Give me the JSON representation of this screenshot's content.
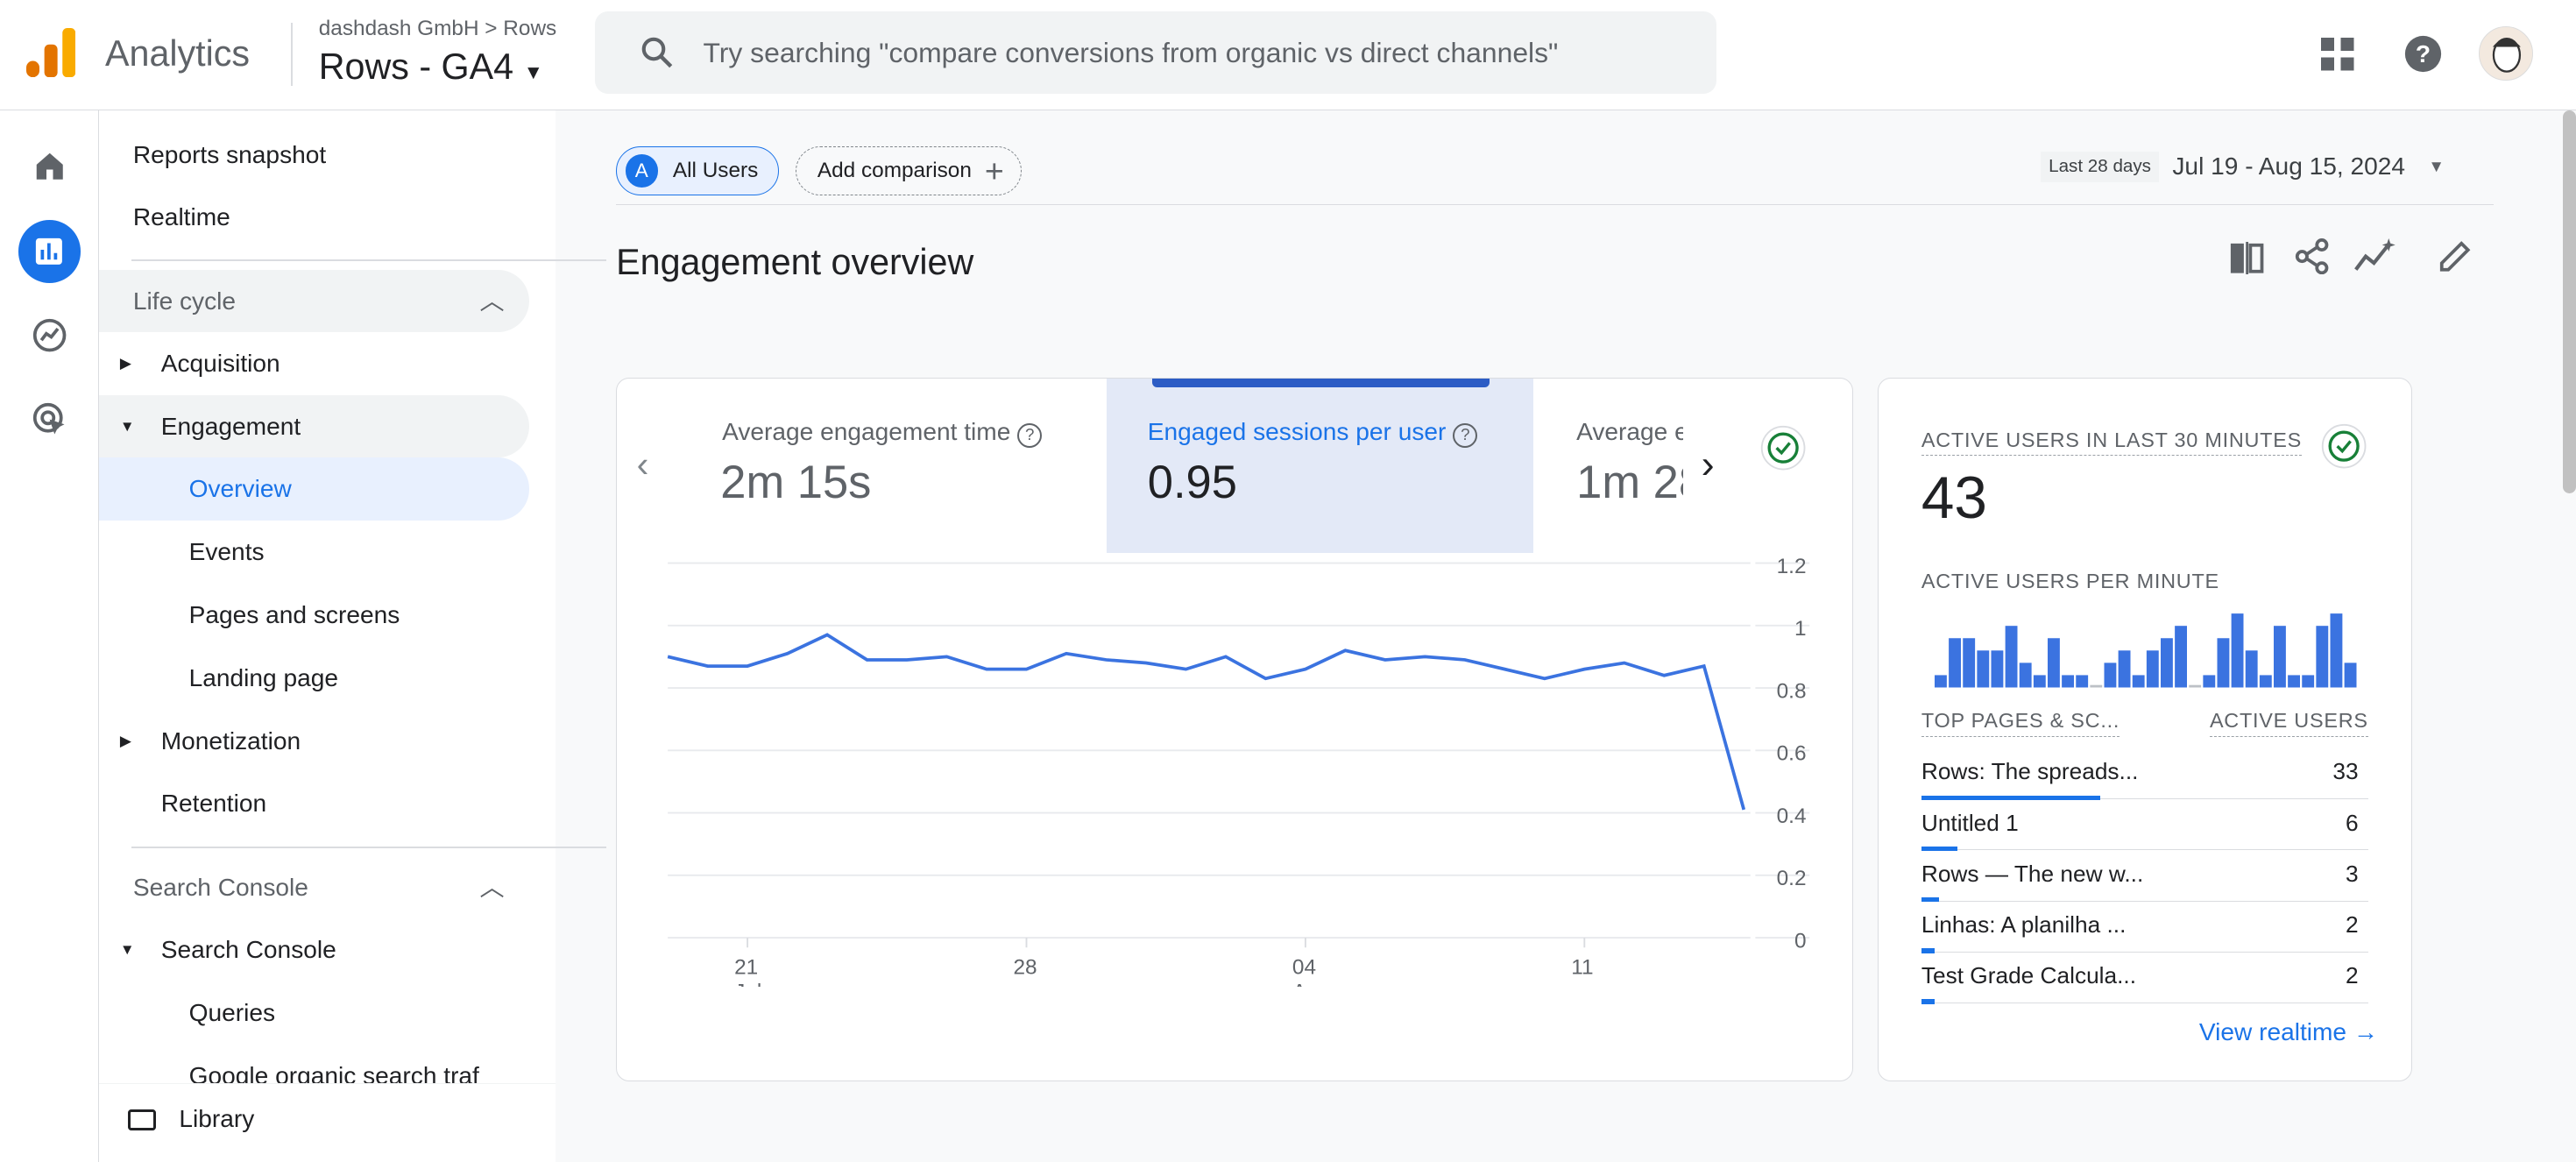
{
  "header": {
    "app_name": "Analytics",
    "breadcrumb": "dashdash GmbH > Rows",
    "property": "Rows - GA4",
    "search_placeholder": "Try searching \"compare conversions from organic vs direct channels\"",
    "icons": [
      "apps-grid-icon",
      "help-icon",
      "avatar"
    ]
  },
  "rail": {
    "icons": [
      "home-icon",
      "reports-icon",
      "explore-icon",
      "advertising-icon"
    ],
    "active": "reports-icon"
  },
  "nav": {
    "top_items": [
      "Reports snapshot",
      "Realtime"
    ],
    "section1": "Life cycle",
    "items": [
      {
        "label": "Acquisition",
        "type": "group"
      },
      {
        "label": "Engagement",
        "type": "group",
        "expanded": true
      },
      {
        "label": "Overview",
        "type": "child",
        "active": true
      },
      {
        "label": "Events",
        "type": "child"
      },
      {
        "label": "Pages and screens",
        "type": "child"
      },
      {
        "label": "Landing page",
        "type": "child"
      },
      {
        "label": "Monetization",
        "type": "group"
      },
      {
        "label": "Retention",
        "type": "plain"
      }
    ],
    "section2": "Search Console",
    "items2": [
      {
        "label": "Search Console",
        "type": "group",
        "expanded": true
      },
      {
        "label": "Queries",
        "type": "child"
      },
      {
        "label": "Google organic search traf",
        "type": "child"
      }
    ],
    "library": "Library"
  },
  "toolbar": {
    "segment_letter": "A",
    "segment": "All Users",
    "add_comparison": "Add comparison",
    "date_badge": "Last 28 days",
    "date_range": "Jul 19 - Aug 15, 2024"
  },
  "page_title": "Engagement overview",
  "page_actions": [
    "compare-icon",
    "share-icon",
    "insights-icon",
    "edit-icon"
  ],
  "metrics": [
    {
      "label": "Average engagement time",
      "value": "2m 15s"
    },
    {
      "label": "Engaged sessions per user",
      "value": "0.95",
      "selected": true
    },
    {
      "label": "Average e",
      "value": "1m 28"
    }
  ],
  "colors": {
    "accent": "#1a73e8",
    "line": "#3b73e0",
    "selected_bg": "#e3e9f7"
  },
  "chart_data": {
    "type": "line",
    "x": [
      "Jul 19",
      "Jul 20",
      "Jul 21",
      "Jul 22",
      "Jul 23",
      "Jul 24",
      "Jul 25",
      "Jul 26",
      "Jul 27",
      "Jul 28",
      "Jul 29",
      "Jul 30",
      "Jul 31",
      "Aug 01",
      "Aug 02",
      "Aug 03",
      "Aug 04",
      "Aug 05",
      "Aug 06",
      "Aug 07",
      "Aug 08",
      "Aug 09",
      "Aug 10",
      "Aug 11",
      "Aug 12",
      "Aug 13",
      "Aug 14",
      "Aug 15"
    ],
    "values": [
      0.9,
      0.87,
      0.87,
      0.91,
      0.97,
      0.89,
      0.89,
      0.9,
      0.86,
      0.86,
      0.91,
      0.89,
      0.88,
      0.86,
      0.9,
      0.83,
      0.86,
      0.92,
      0.89,
      0.9,
      0.89,
      0.86,
      0.83,
      0.86,
      0.88,
      0.84,
      0.87,
      0.41
    ],
    "ylim": [
      0,
      1.2
    ],
    "yticks": [
      "1.2",
      "1",
      "0.8",
      "0.6",
      "0.4",
      "0.2",
      "0"
    ],
    "xticks": [
      {
        "day": "21",
        "month": "Jul",
        "index": 2
      },
      {
        "day": "28",
        "month": "",
        "index": 9
      },
      {
        "day": "04",
        "month": "Aug",
        "index": 16
      },
      {
        "day": "11",
        "month": "",
        "index": 23
      }
    ],
    "grid": true
  },
  "realtime": {
    "title": "ACTIVE USERS IN LAST 30 MINUTES",
    "count": "43",
    "per_minute_label": "ACTIVE USERS PER MINUTE",
    "per_minute": [
      1,
      4,
      4,
      3,
      3,
      5,
      2,
      1,
      4,
      1,
      1,
      0,
      2,
      3,
      1,
      3,
      4,
      5,
      0,
      1,
      4,
      6,
      3,
      1,
      5,
      1,
      1,
      5,
      6,
      2
    ],
    "col1": "TOP PAGES & SC...",
    "col2": "ACTIVE USERS",
    "rows": [
      {
        "name": "Rows: The spreads...",
        "value": "33",
        "frac": 0.4
      },
      {
        "name": "Untitled 1",
        "value": "6",
        "frac": 0.08
      },
      {
        "name": "Rows — The new w...",
        "value": "3",
        "frac": 0.04
      },
      {
        "name": "Linhas: A planilha ...",
        "value": "2",
        "frac": 0.03
      },
      {
        "name": "Test Grade Calcula...",
        "value": "2",
        "frac": 0.03
      }
    ],
    "view_link": "View realtime"
  }
}
